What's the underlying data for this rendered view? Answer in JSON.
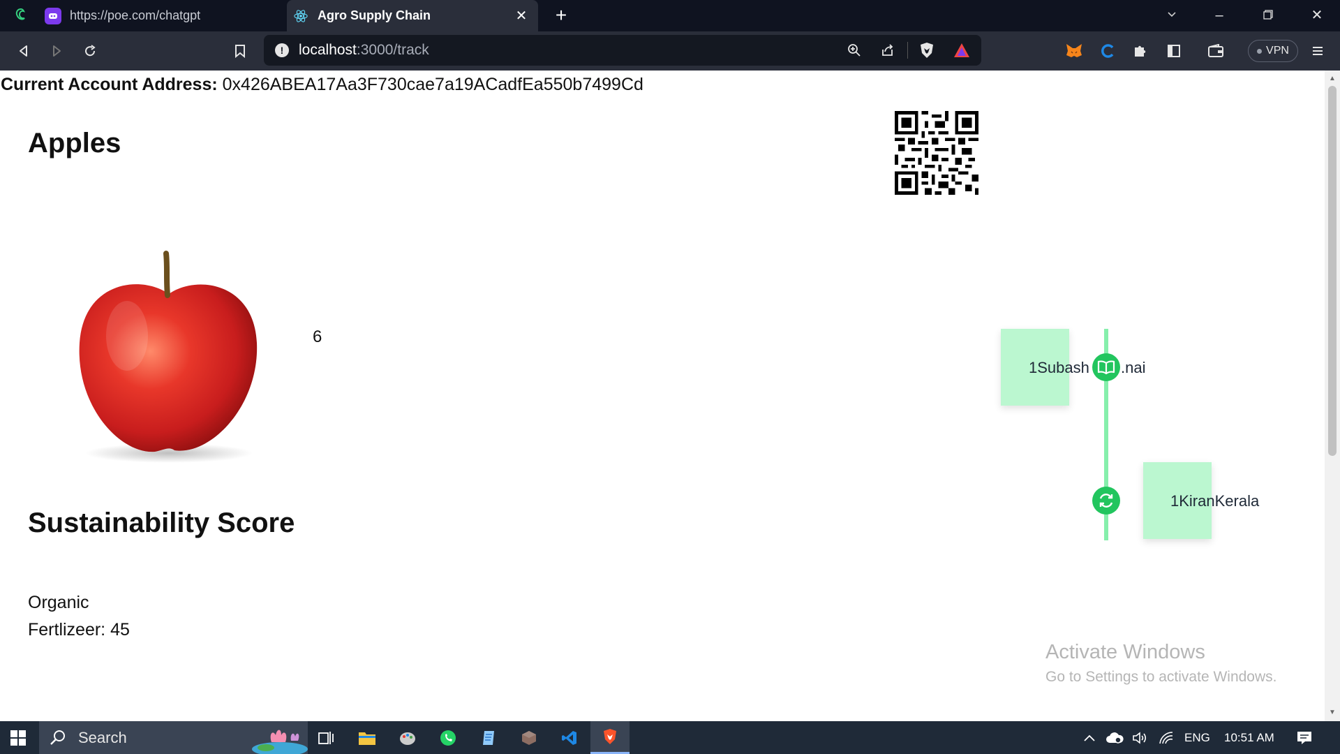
{
  "browser": {
    "tabs": [
      {
        "title": "https://poe.com/chatgpt",
        "icon": "poe-icon",
        "active": false
      },
      {
        "title": "Agro Supply Chain",
        "icon": "react-icon",
        "active": true
      }
    ],
    "url_host": "localhost",
    "url_path": ":3000/track",
    "vpn_label": "VPN"
  },
  "page": {
    "account_label": "Current Account Address:",
    "account_value": "0x426ABEA17Aa3F730cae7a19ACadfEa550b7499Cd",
    "product_title": "Apples",
    "quantity": "6",
    "timeline": [
      {
        "name": "1Subash",
        "location_fragment": "nai",
        "icon": "book-icon"
      },
      {
        "name": "1KiranKerala",
        "icon": "refresh-icon"
      }
    ],
    "sustainability": {
      "title": "Sustainability Score",
      "type": "Organic",
      "fertilizer": "Fertlizeer: 45"
    }
  },
  "watermark": {
    "line1": "Activate Windows",
    "line2": "Go to Settings to activate Windows."
  },
  "taskbar": {
    "search_placeholder": "Search",
    "language": "ENG",
    "time": "10:51 AM"
  },
  "colors": {
    "timeline_card": "#bbf7d0",
    "timeline_line": "#86efac",
    "timeline_dot": "#22c55e"
  }
}
